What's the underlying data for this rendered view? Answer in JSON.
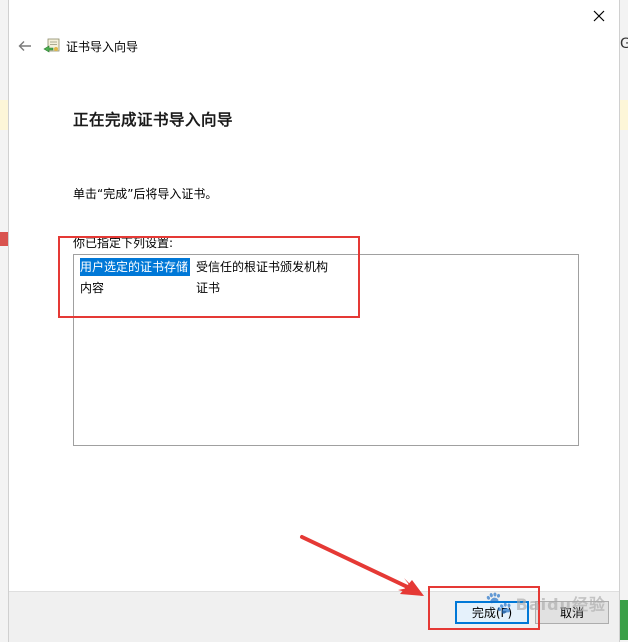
{
  "window": {
    "title": "证书导入向导",
    "close_icon": "close-icon",
    "back_icon": "back-arrow-icon",
    "wizard_icon": "certificate-wizard-icon"
  },
  "main": {
    "heading": "正在完成证书导入向导",
    "instruction": "单击“完成”后将导入证书。",
    "settings_label": "你已指定下列设置:",
    "settings": [
      {
        "key": "用户选定的证书存储",
        "value": "受信任的根证书颁发机构",
        "selected": true
      },
      {
        "key": "内容",
        "value": "证书",
        "selected": false
      }
    ]
  },
  "footer": {
    "finish_label": "完成(F)",
    "cancel_label": "取消"
  },
  "background": {
    "right_glyph": "G"
  },
  "watermark": {
    "text": "Baidu经验"
  },
  "colors": {
    "selection": "#0078d7",
    "annotation": "#e53935",
    "footer_bg": "#f0f0f0"
  }
}
